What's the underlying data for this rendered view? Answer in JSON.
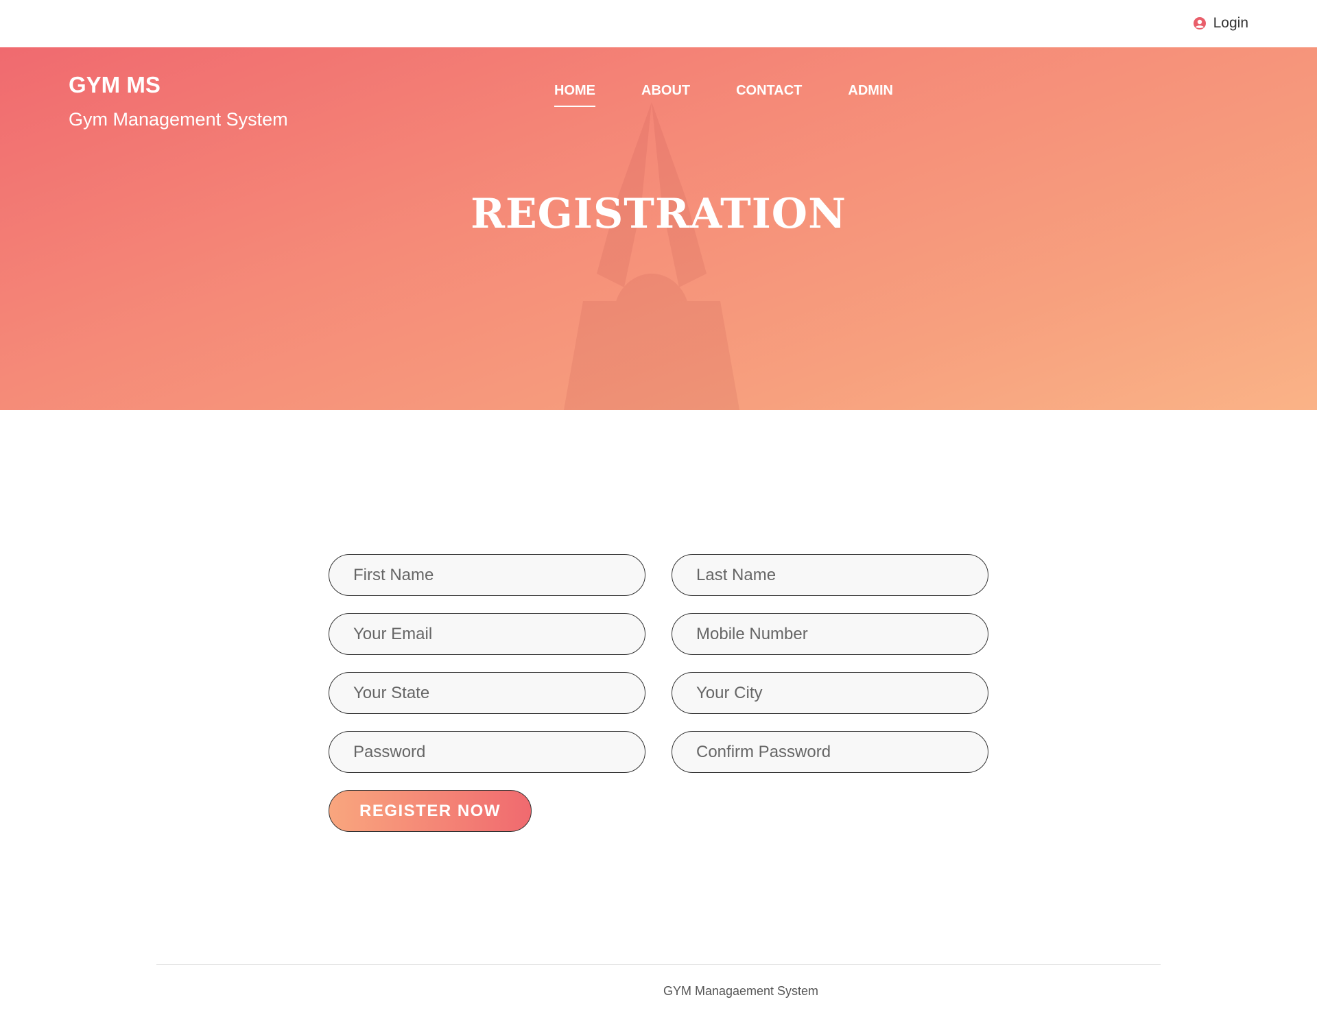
{
  "topbar": {
    "login_label": "Login",
    "login_icon": "user-circle-icon",
    "accent_color": "#e95e6a"
  },
  "hero": {
    "brand_title": "GYM MS",
    "brand_subtitle": "Gym Management System",
    "heading": "REGISTRATION",
    "gradient_colors": [
      "#f06a6f",
      "#fab387"
    ],
    "nav": [
      {
        "label": "HOME",
        "active": true
      },
      {
        "label": "ABOUT",
        "active": false
      },
      {
        "label": "CONTACT",
        "active": false
      },
      {
        "label": "ADMIN",
        "active": false
      }
    ]
  },
  "form": {
    "first_name_placeholder": "First Name",
    "last_name_placeholder": "Last Name",
    "email_placeholder": "Your Email",
    "mobile_placeholder": "Mobile Number",
    "state_placeholder": "Your State",
    "city_placeholder": "Your City",
    "password_placeholder": "Password",
    "confirm_password_placeholder": "Confirm Password",
    "register_label": "REGISTER NOW"
  },
  "footer": {
    "text": "GYM Managaement System"
  }
}
